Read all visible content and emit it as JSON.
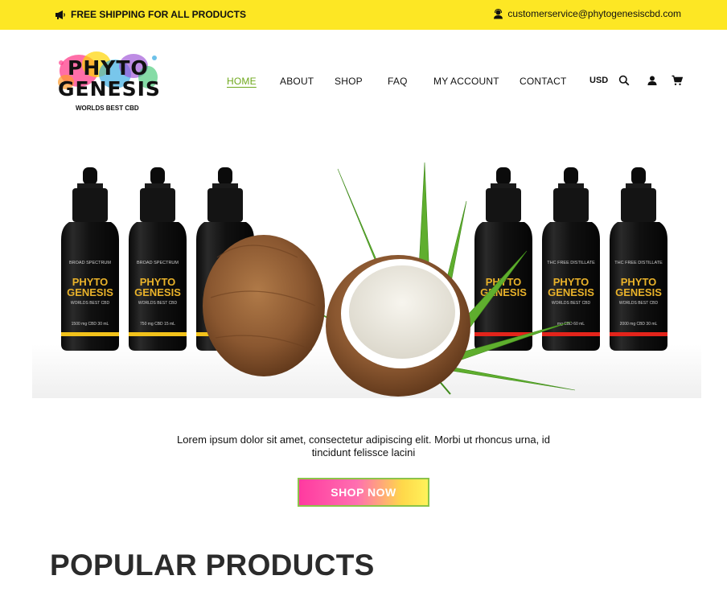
{
  "topbar": {
    "promo_text": "FREE SHIPPING FOR ALL PRODUCTS",
    "promo_icon": "megaphone-icon",
    "email": "customerservice@phytogenesiscbd.com",
    "email_icon": "support-agent-icon",
    "bg_color": "#fde724"
  },
  "logo": {
    "line1": "PHYTO",
    "line2": "GENESIS",
    "tagline": "WORLDS BEST CBD"
  },
  "nav": {
    "items": [
      {
        "label": "HOME",
        "active": true
      },
      {
        "label": "ABOUT"
      },
      {
        "label": "SHOP"
      },
      {
        "label": "FAQ"
      },
      {
        "label": "MY ACCOUNT"
      },
      {
        "label": "CONTACT"
      }
    ],
    "currency": "USD",
    "icons": [
      "search-icon",
      "user-icon",
      "cart-icon"
    ],
    "active_color": "#6fa81c"
  },
  "hero": {
    "bottles": [
      {
        "type": "BROAD SPECTRUM",
        "brand1": "PHYTO",
        "brand2": "GENESIS",
        "sub": "WORLDS BEST CBD",
        "dose": "1500 mg CBD 30 mL",
        "band": "#f2c21b"
      },
      {
        "type": "BROAD SPECTRUM",
        "brand1": "PHYTO",
        "brand2": "GENESIS",
        "sub": "WORLDS BEST CBD",
        "dose": "750 mg CBD 15 mL",
        "band": "#f2c21b"
      },
      {
        "type": "",
        "brand1": "",
        "brand2": "",
        "sub": "",
        "dose": "",
        "band": "#f2c21b"
      },
      {
        "type": "",
        "brand1": "PHYTO",
        "brand2": "GENESIS",
        "sub": "",
        "dose": "",
        "band": "#e3241b"
      },
      {
        "type": "THC FREE DISTILLATE",
        "brand1": "PHYTO",
        "brand2": "GENESIS",
        "sub": "WORLDS BEST CBD",
        "dose": "mg CBD 60 mL",
        "band": "#e3241b"
      },
      {
        "type": "THC FREE DISTILLATE",
        "brand1": "PHYTO",
        "brand2": "GENESIS",
        "sub": "WORLDS BEST CBD",
        "dose": "2000 mg CBD 30 mL",
        "band": "#e3241b"
      }
    ]
  },
  "intro": {
    "text": "Lorem ipsum dolor sit amet, consectetur adipiscing elit. Morbi ut rhoncus urna, id tincidunt felissce lacini"
  },
  "cta": {
    "label": "SHOP NOW"
  },
  "sections": {
    "popular_title": "POPULAR PRODUCTS"
  }
}
